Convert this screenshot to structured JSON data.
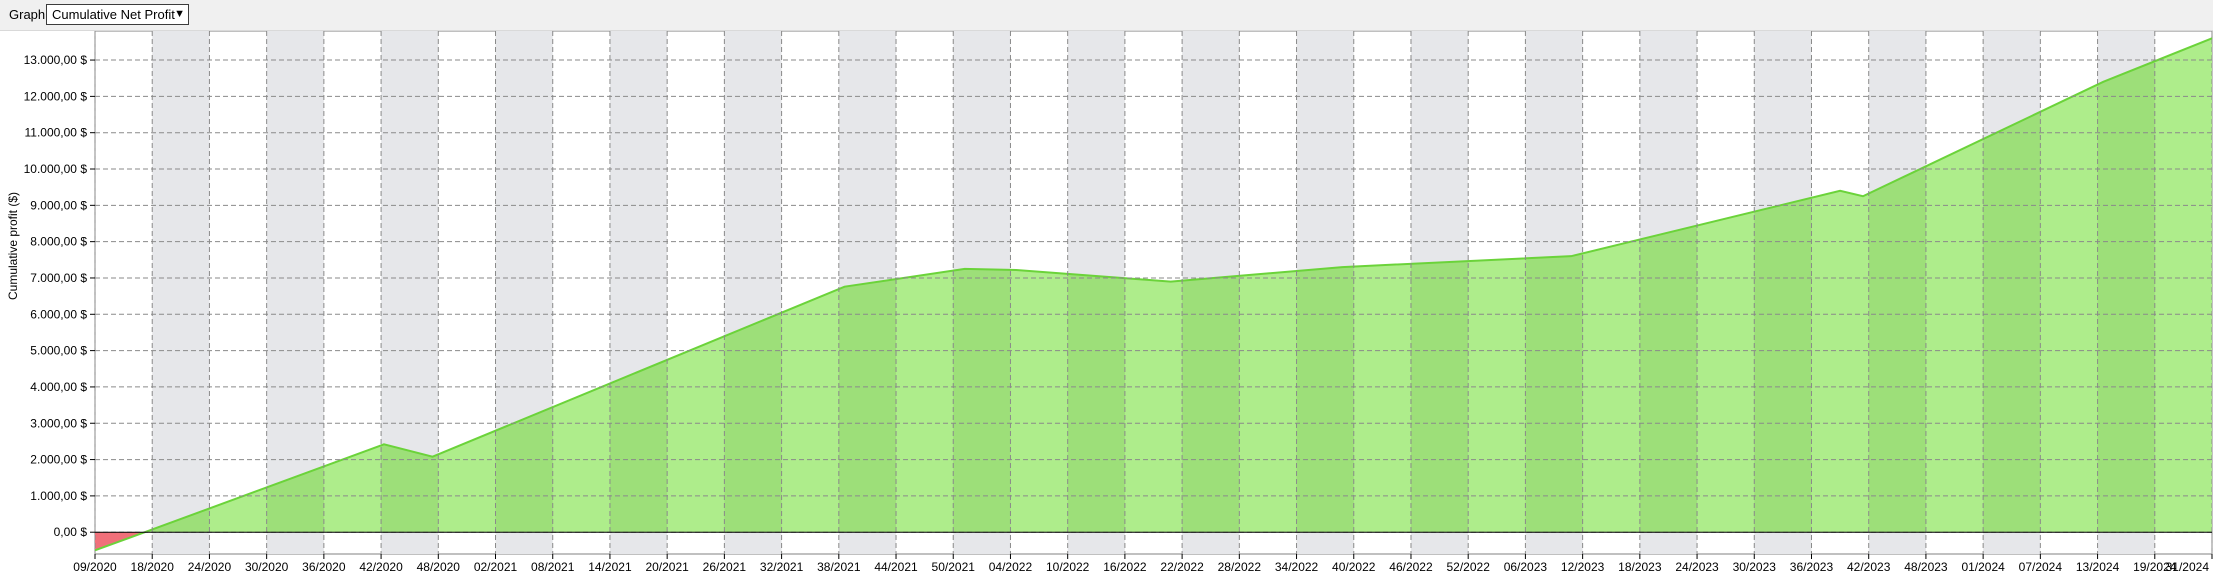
{
  "toolbar": {
    "label": "Graph",
    "selected": "Cumulative Net Profit",
    "arrow_icon": "chevron-down-icon"
  },
  "colors": {
    "area_positive": "#aeed8b",
    "area_positive_band": "#9ddf79",
    "line": "#6bd33a",
    "area_negative": "#f0707a",
    "band": "#e6e7ea",
    "grid": "#8a8a8a"
  },
  "chart_data": {
    "type": "area",
    "title": "",
    "ylabel": "Cumulative profit ($)",
    "xlabel": "",
    "ylim": [
      -600,
      13800
    ],
    "yticks": [
      {
        "value": 0,
        "label": "0,00 $"
      },
      {
        "value": 1000,
        "label": "1.000,00 $"
      },
      {
        "value": 2000,
        "label": "2.000,00 $"
      },
      {
        "value": 3000,
        "label": "3.000,00 $"
      },
      {
        "value": 4000,
        "label": "4.000,00 $"
      },
      {
        "value": 5000,
        "label": "5.000,00 $"
      },
      {
        "value": 6000,
        "label": "6.000,00 $"
      },
      {
        "value": 7000,
        "label": "7.000,00 $"
      },
      {
        "value": 8000,
        "label": "8.000,00 $"
      },
      {
        "value": 9000,
        "label": "9.000,00 $"
      },
      {
        "value": 10000,
        "label": "10.000,00 $"
      },
      {
        "value": 11000,
        "label": "11.000,00 $"
      },
      {
        "value": 12000,
        "label": "12.000,00 $"
      },
      {
        "value": 13000,
        "label": "13.000,00 $"
      }
    ],
    "x_categories": [
      "09/2020",
      "18/2020",
      "24/2020",
      "30/2020",
      "36/2020",
      "42/2020",
      "48/2020",
      "02/2021",
      "08/2021",
      "14/2021",
      "20/2021",
      "26/2021",
      "32/2021",
      "38/2021",
      "44/2021",
      "50/2021",
      "04/2022",
      "10/2022",
      "16/2022",
      "22/2022",
      "28/2022",
      "34/2022",
      "40/2022",
      "46/2022",
      "52/2022",
      "06/2023",
      "12/2023",
      "18/2023",
      "24/2023",
      "30/2023",
      "36/2023",
      "42/2023",
      "48/2023",
      "01/2024",
      "07/2024",
      "13/2024",
      "19/2024",
      "31/2024"
    ],
    "x_range": [
      0,
      37
    ],
    "grid": true,
    "series": [
      {
        "points": [
          {
            "x": 0,
            "y": -500
          },
          {
            "x": 0.87,
            "y": 0
          },
          {
            "x": 5.05,
            "y": 2420
          },
          {
            "x": 5.9,
            "y": 2080
          },
          {
            "x": 13.1,
            "y": 6760
          },
          {
            "x": 15.2,
            "y": 7250
          },
          {
            "x": 16.1,
            "y": 7220
          },
          {
            "x": 18.8,
            "y": 6900
          },
          {
            "x": 21.8,
            "y": 7300
          },
          {
            "x": 25.8,
            "y": 7600
          },
          {
            "x": 30.5,
            "y": 9400
          },
          {
            "x": 30.9,
            "y": 9250
          },
          {
            "x": 35.1,
            "y": 12400
          },
          {
            "x": 37,
            "y": 13600
          }
        ]
      }
    ]
  }
}
